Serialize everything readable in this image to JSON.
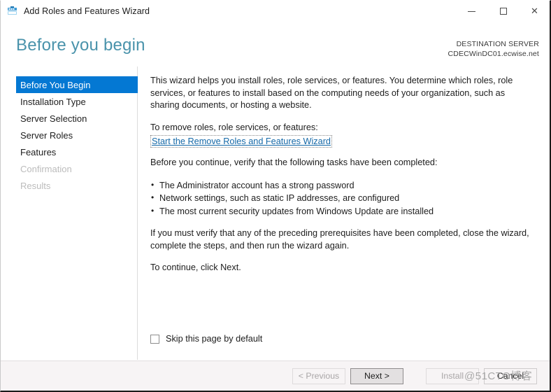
{
  "window": {
    "title": "Add Roles and Features Wizard",
    "icon": "wizard-server-icon",
    "caption": {
      "minimize": "–",
      "maximize": "□",
      "close": "✕"
    }
  },
  "header": {
    "page_title": "Before you begin",
    "destination_label": "DESTINATION SERVER",
    "destination_server": "CDECWinDC01.ecwise.net",
    "title_color": "#4a93ab"
  },
  "sidebar": {
    "items": [
      {
        "label": "Before You Begin",
        "state": "selected"
      },
      {
        "label": "Installation Type",
        "state": "normal"
      },
      {
        "label": "Server Selection",
        "state": "normal"
      },
      {
        "label": "Server Roles",
        "state": "normal"
      },
      {
        "label": "Features",
        "state": "normal"
      },
      {
        "label": "Confirmation",
        "state": "disabled"
      },
      {
        "label": "Results",
        "state": "disabled"
      }
    ],
    "selected_color": "#0478d3"
  },
  "main": {
    "intro": "This wizard helps you install roles, role services, or features. You determine which roles, role services, or features to install based on the computing needs of your organization, such as sharing documents, or hosting a website.",
    "remove_prompt": "To remove roles, role services, or features:",
    "remove_link": "Start the Remove Roles and Features Wizard",
    "verify_prompt": "Before you continue, verify that the following tasks have been completed:",
    "tasks": [
      "The Administrator account has a strong password",
      "Network settings, such as static IP addresses, are configured",
      "The most current security updates from Windows Update are installed"
    ],
    "prereq_note": "If you must verify that any of the preceding prerequisites have been completed, close the wizard, complete the steps, and then run the wizard again.",
    "continue_note": "To continue, click Next.",
    "skip_checkbox_label": "Skip this page by default",
    "skip_checkbox_checked": false
  },
  "footer": {
    "buttons": [
      {
        "label": "< Previous",
        "state": "disabled"
      },
      {
        "label": "Next >",
        "state": "default"
      },
      {
        "label": "Install",
        "state": "disabled"
      },
      {
        "label": "Cancel",
        "state": "normal"
      }
    ]
  },
  "watermark": {
    "text": "@51CTO博客"
  }
}
